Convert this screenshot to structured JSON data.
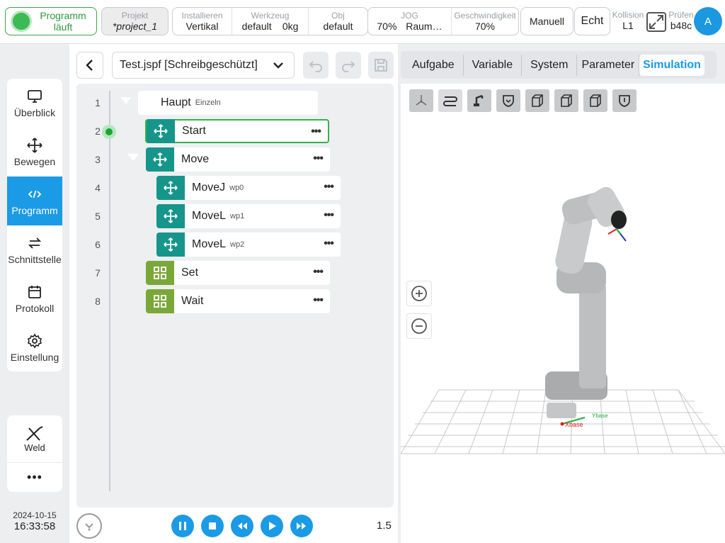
{
  "status": {
    "label": "Programm läuft",
    "color": "#3cba54"
  },
  "project": {
    "label": "Projekt",
    "value": "*project_1"
  },
  "install": {
    "label": "Installieren",
    "value": "Vertikal"
  },
  "tool": {
    "label": "Werkzeug",
    "value": "default",
    "weight": "0kg"
  },
  "obj": {
    "label": "Obj",
    "value": "default"
  },
  "jog": {
    "label": "JOG",
    "value": "70%",
    "frame": "Raum…"
  },
  "speed_top": {
    "label": "Geschwindigkeit",
    "value": "70%"
  },
  "mode_manual": "Manuell",
  "mode_real": "Echt",
  "collision": {
    "label": "Kollision",
    "value": "L1"
  },
  "check": {
    "label": "Prüfen",
    "value": "b48c"
  },
  "avatar": "A",
  "nav": [
    {
      "label": "Überblick",
      "icon": "monitor-icon"
    },
    {
      "label": "Bewegen",
      "icon": "move-icon"
    },
    {
      "label": "Programm",
      "icon": "code-icon"
    },
    {
      "label": "Schnittstelle",
      "icon": "swap-icon"
    },
    {
      "label": "Protokoll",
      "icon": "calendar-icon"
    },
    {
      "label": "Einstellung",
      "icon": "gear-icon"
    }
  ],
  "nav_weld": "Weld",
  "nav_more": "•••",
  "date": "2024-10-15",
  "time": "16:33:58",
  "file": "Test.jspf [Schreibgeschützt]",
  "program": [
    {
      "line": "1",
      "name": "Haupt",
      "sub": "Einzeln",
      "type": "root"
    },
    {
      "line": "2",
      "name": "Start",
      "sub": "",
      "type": "move"
    },
    {
      "line": "3",
      "name": "Move",
      "sub": "",
      "type": "move"
    },
    {
      "line": "4",
      "name": "MoveJ",
      "sub": "wp0",
      "type": "move"
    },
    {
      "line": "5",
      "name": "MoveL",
      "sub": "wp1",
      "type": "move"
    },
    {
      "line": "6",
      "name": "MoveL",
      "sub": "wp2",
      "type": "move"
    },
    {
      "line": "7",
      "name": "Set",
      "sub": "",
      "type": "grid"
    },
    {
      "line": "8",
      "name": "Wait",
      "sub": "",
      "type": "grid"
    }
  ],
  "dots": "•••",
  "play_speed": "1.5",
  "tabs": [
    "Aufgabe",
    "Variable",
    "System",
    "Parameter",
    "Simulation"
  ],
  "active_tab": "Simulation",
  "scene_labels": {
    "x": "Xbase",
    "y": "Ybase"
  },
  "colors": {
    "accent": "#1b9ae6",
    "teal": "#16968a",
    "green": "#7aa838",
    "status": "#3cba54"
  }
}
